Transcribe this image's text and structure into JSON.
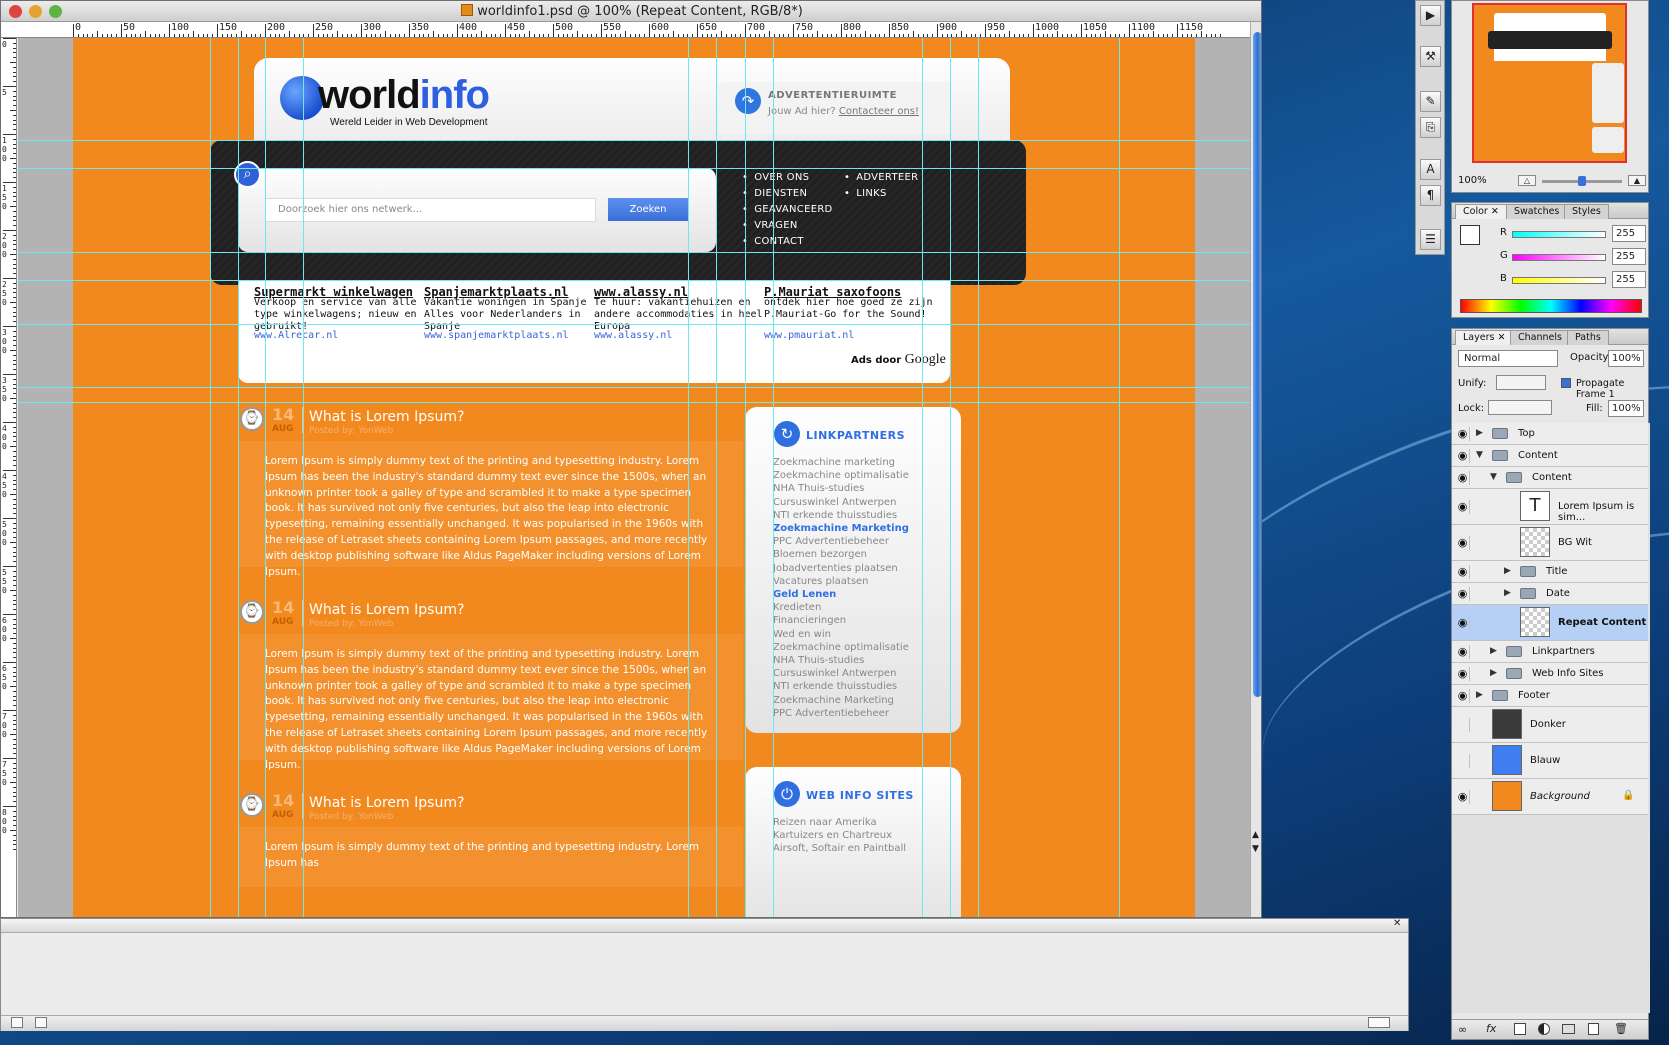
{
  "window": {
    "title": "worldinfo1.psd @ 100% (Repeat Content, RGB/8*)"
  },
  "ruler": {
    "h_labels": [
      "0",
      "50",
      "100",
      "150",
      "200",
      "250",
      "300",
      "350",
      "400",
      "450",
      "500",
      "550",
      "600",
      "650",
      "700",
      "750",
      "800",
      "850",
      "900",
      "950",
      "1000",
      "1050",
      "1100",
      "1150"
    ],
    "v_labels": [
      "0",
      "5",
      "1 0 0",
      "1 5 0",
      "2 0 0",
      "2 5 0",
      "3 0 0",
      "3 5 0",
      "4 0 0",
      "4 5 0",
      "5 0 0",
      "5 5 0",
      "6 0 0",
      "6 5 0",
      "7 0 0",
      "7 5 0",
      "8 0 0"
    ]
  },
  "site": {
    "logo_left": "world",
    "logo_right": "info",
    "tagline": "Wereld Leider in Web Development",
    "ad_title": "ADVERTENTIERUIMTE",
    "ad_sub_prefix": "Jouw Ad hier?",
    "ad_sub_link": "Contacteer ons!",
    "search_placeholder": "Doorzoek hier ons netwerk...",
    "search_button": "Zoeken",
    "nav_col1": [
      "OVER ONS",
      "DIENSTEN",
      "GEAVANCEERD",
      "VRAGEN",
      "CONTACT"
    ],
    "nav_col2": [
      "ADVERTEER",
      "LINKS"
    ],
    "ads": [
      {
        "title": "Supermarkt winkelwagen",
        "desc": "Verkoop en service van alle type winkelwagens; nieuw en gebruikt!",
        "url": "www.Alrecar.nl"
      },
      {
        "title": "Spanjemarktplaats.nl",
        "desc": "Vakantie woningen in Spanje Alles voor Nederlanders in Spanje",
        "url": "www.spanjemarktplaats.nl"
      },
      {
        "title": "www.alassy.nl",
        "desc": "Te huur: vakantiehuizen en andere accommodaties in heel Europa",
        "url": "www.alassy.nl"
      },
      {
        "title": "P.Mauriat saxofoons",
        "desc": "ontdek hier hoe goed ze zijn P.Mauriat-Go for the Sound!",
        "url": "www.pmauriat.nl"
      }
    ],
    "ads_by": "Ads door",
    "ads_brand": "Google",
    "posts": [
      {
        "day": "14",
        "month": "AUG",
        "title": "What is Lorem Ipsum?",
        "by": "Posted by: YonWeb",
        "body": "Lorem Ipsum is simply dummy text of the printing and typesetting industry. Lorem Ipsum has been the industry's standard dummy text ever since the 1500s, when an unknown printer took a galley of type and scrambled it to make a type specimen book. It has survived not only five centuries, but also the leap into electronic typesetting, remaining essentially unchanged. It was popularised in the 1960s with the release of Letraset sheets containing Lorem Ipsum passages, and more recently with desktop publishing software like Aldus PageMaker including versions of Lorem Ipsum."
      },
      {
        "day": "14",
        "month": "AUG",
        "title": "What is Lorem Ipsum?",
        "by": "Posted by: YonWeb",
        "body": "Lorem Ipsum is simply dummy text of the printing and typesetting industry. Lorem Ipsum has been the industry's standard dummy text ever since the 1500s, when an unknown printer took a galley of type and scrambled it to make a type specimen book. It has survived not only five centuries, but also the leap into electronic typesetting, remaining essentially unchanged. It was popularised in the 1960s with the release of Letraset sheets containing Lorem Ipsum passages, and more recently with desktop publishing software like Aldus PageMaker including versions of Lorem Ipsum."
      },
      {
        "day": "14",
        "month": "AUG",
        "title": "What is Lorem Ipsum?",
        "by": "Posted by: YonWeb",
        "body": "Lorem Ipsum is simply dummy text of the printing and typesetting industry. Lorem Ipsum has"
      }
    ],
    "linkpartners_title": "LINKPARTNERS",
    "linkpartners": [
      {
        "text": "Zoekmachine marketing",
        "hl": false
      },
      {
        "text": "Zoekmachine optimalisatie",
        "hl": false
      },
      {
        "text": "NHA Thuis-studies",
        "hl": false
      },
      {
        "text": "Cursuswinkel Antwerpen",
        "hl": false
      },
      {
        "text": "NTI erkende thuisstudies",
        "hl": false
      },
      {
        "text": "Zoekmachine Marketing",
        "hl": true
      },
      {
        "text": "PPC Advertentiebeheer",
        "hl": false
      },
      {
        "text": "Bloemen bezorgen",
        "hl": false
      },
      {
        "text": "Jobadvertenties plaatsen",
        "hl": false
      },
      {
        "text": "Vacatures plaatsen",
        "hl": false
      },
      {
        "text": "Geld Lenen",
        "hl": true
      },
      {
        "text": "Kredieten",
        "hl": false
      },
      {
        "text": "Financieringen",
        "hl": false
      },
      {
        "text": "Wed en win",
        "hl": false
      },
      {
        "text": "Zoekmachine optimalisatie",
        "hl": false
      },
      {
        "text": "NHA Thuis-studies",
        "hl": false
      },
      {
        "text": "Cursuswinkel Antwerpen",
        "hl": false
      },
      {
        "text": "NTI erkende thuisstudies",
        "hl": false
      },
      {
        "text": "Zoekmachine Marketing",
        "hl": false
      },
      {
        "text": "PPC Advertentiebeheer",
        "hl": false
      }
    ],
    "webinfo_title": "WEB INFO SITES",
    "webinfo": [
      "Reizen naar Amerika",
      "Kartuizers en Chartreux",
      "Airsoft, Softair en Paintball"
    ]
  },
  "navigator": {
    "zoom": "100%"
  },
  "color_panel": {
    "tabs": [
      "Color",
      "Swatches",
      "Styles"
    ],
    "r_label": "R",
    "g_label": "G",
    "b_label": "B",
    "r": "255",
    "g": "255",
    "b": "255"
  },
  "layers_panel": {
    "tabs": [
      "Layers",
      "Channels",
      "Paths"
    ],
    "blend_mode": "Normal",
    "opacity_label": "Opacity:",
    "opacity": "100%",
    "unify_label": "Unify:",
    "propagate_label": "Propagate Frame 1",
    "lock_label": "Lock:",
    "fill_label": "Fill:",
    "fill": "100%",
    "layers": [
      {
        "name": "Top",
        "type": "folder",
        "indent": 0,
        "open": false,
        "eye": true
      },
      {
        "name": "Content",
        "type": "folder",
        "indent": 0,
        "open": true,
        "eye": true
      },
      {
        "name": "Content",
        "type": "folder",
        "indent": 1,
        "open": true,
        "eye": true
      },
      {
        "name": "Lorem Ipsum is sim...",
        "type": "text",
        "indent": 2,
        "eye": true
      },
      {
        "name": "BG Wit",
        "type": "layer",
        "indent": 2,
        "eye": true
      },
      {
        "name": "Title",
        "type": "folder",
        "indent": 2,
        "open": false,
        "eye": true
      },
      {
        "name": "Date",
        "type": "folder",
        "indent": 2,
        "open": false,
        "eye": true
      },
      {
        "name": "Repeat Content",
        "type": "layer",
        "indent": 2,
        "eye": true,
        "selected": true
      },
      {
        "name": "Linkpartners",
        "type": "folder",
        "indent": 1,
        "open": false,
        "eye": true
      },
      {
        "name": "Web Info Sites",
        "type": "folder",
        "indent": 1,
        "open": false,
        "eye": true
      },
      {
        "name": "Footer",
        "type": "folder",
        "indent": 0,
        "open": false,
        "eye": true
      },
      {
        "name": "Donker",
        "type": "fill",
        "indent": 0,
        "eye": false,
        "color": "#3a3a3a"
      },
      {
        "name": "Blauw",
        "type": "fill",
        "indent": 0,
        "eye": false,
        "color": "#3f7df0"
      },
      {
        "name": "Background",
        "type": "fill",
        "indent": 0,
        "eye": true,
        "color": "#f2891f",
        "locked": true
      }
    ]
  },
  "colors": {
    "orange": "#f2891f",
    "blue": "#2f6fe0",
    "dark": "#222222"
  }
}
